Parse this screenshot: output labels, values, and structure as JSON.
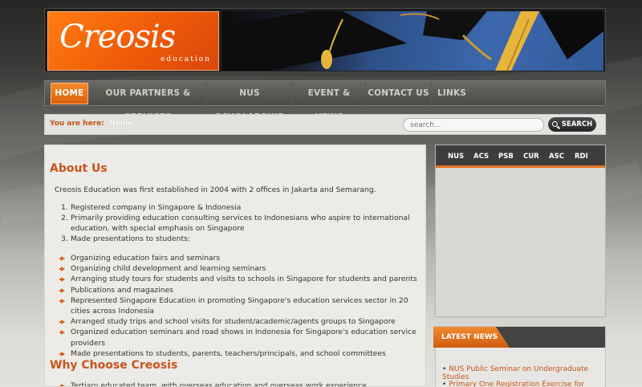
{
  "colors": {
    "accent": "#e0691c",
    "link": "#c8541a",
    "nav_bg": "#55544f"
  },
  "logo": {
    "word": "Creosis",
    "sub": "education"
  },
  "nav": {
    "items": [
      "HOME",
      "OUR PARTNERS & SERVICES",
      "NUS SCHOLARSHIP",
      "EVENT & NEWS",
      "CONTACT US",
      "LINKS"
    ],
    "active": "HOME"
  },
  "breadcrumb": {
    "prefix": "You are here:",
    "current": "Home"
  },
  "search": {
    "placeholder": "search...",
    "button_label": "SEARCH",
    "icon": "search-icon"
  },
  "main": {
    "about_title": "About Us",
    "intro": "Creosis Education was first established in 2004 with 2 offices in Jakarta and Semarang.",
    "numbered": [
      "Registered company in Singapore & Indonesia",
      "Primarily providing education consulting services to Indonesians who aspire to international education, with special emphasis on Singapore",
      "Made presentations to students:"
    ],
    "bullets": [
      "Organizing education fairs and seminars",
      "Organizing child development and learning seminars",
      "Arranging study tours for students and visits to schools in Singapore for students and parents",
      "Publications and magazines",
      "Represented Singapore Education in promoting Singapore's education services sector in 20 cities across Indonesia",
      "Arranged study trips and school visits for student/academic/agents groups to Singapore",
      "Organized education seminars and road shows in Indonesia for Singapore's education service providers",
      "Made presentations to students, parents, teachers/principals, and school committees"
    ],
    "why_title": "Why Choose Creosis",
    "why_first": "Tertiary educated team, with overseas education and overseas work experience"
  },
  "widget": {
    "tabs": [
      "NUS",
      "ACS",
      "PSB",
      "CUR",
      "ASC",
      "RDI"
    ]
  },
  "news": {
    "title": "LATEST NEWS",
    "items": [
      "NUS Public Seminar on Undergraduate Studies",
      "Primary One Registration Exercise for Foreign"
    ]
  }
}
